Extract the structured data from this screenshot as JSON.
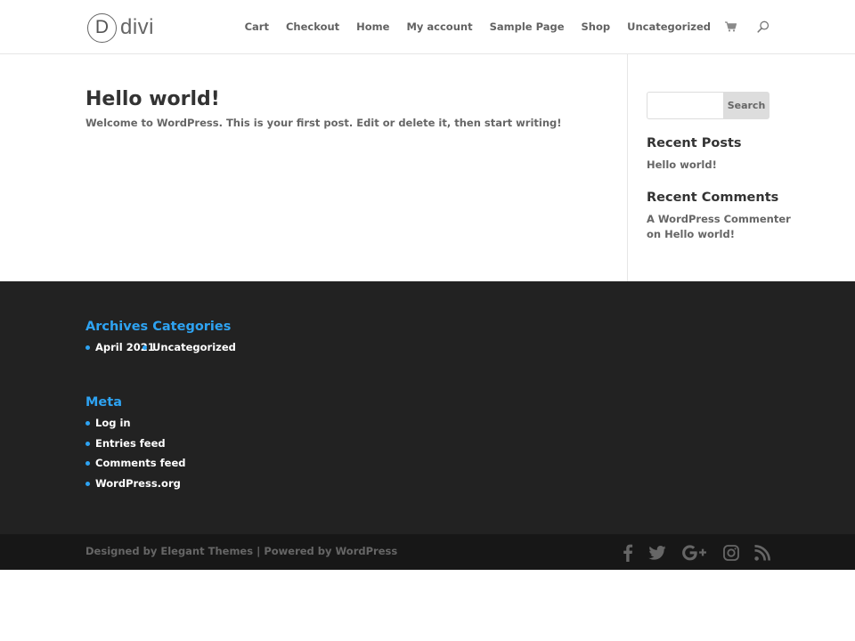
{
  "header": {
    "logo_mark": "D",
    "logo_text": "divi",
    "nav": [
      "Cart",
      "Checkout",
      "Home",
      "My account",
      "Sample Page",
      "Shop",
      "Uncategorized"
    ]
  },
  "post": {
    "title": "Hello world!",
    "excerpt": "Welcome to WordPress. This is your first post. Edit or delete it, then start writing!"
  },
  "sidebar": {
    "search": {
      "value": "",
      "button_label": "Search"
    },
    "recent_posts": {
      "title": "Recent Posts",
      "items": [
        "Hello world!"
      ]
    },
    "recent_comments": {
      "title": "Recent Comments",
      "author": "A WordPress Commenter",
      "on_word": "on",
      "post": "Hello world!"
    }
  },
  "footer": {
    "archives_title": "Archives",
    "archives_items": [
      "April 2021"
    ],
    "categories_title": "Categories",
    "categories_items": [
      "Uncategorized"
    ],
    "meta_title": "Meta",
    "meta_items": [
      "Log in",
      "Entries feed",
      "Comments feed",
      "WordPress.org"
    ]
  },
  "footer_bottom": {
    "designed_by": "Designed by",
    "elegant_themes": "Elegant Themes",
    "separator": "|",
    "powered_by": "Powered by",
    "wordpress": "WordPress",
    "social_icons": [
      "facebook-icon",
      "twitter-icon",
      "google-plus-icon",
      "instagram-icon",
      "rss-icon"
    ]
  },
  "colors": {
    "accent": "#2ea3f2",
    "footer_bg": "#222222",
    "footer_bottom_bg": "#171717"
  }
}
